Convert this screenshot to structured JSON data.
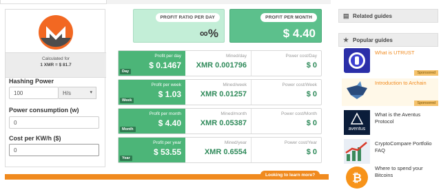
{
  "left": {
    "calculated_for": "Calculated for",
    "rate": "1 XMR = $ 81.7",
    "hashing_label": "Hashing Power",
    "hashing_value": "100",
    "hashing_unit": "H/s",
    "power_label": "Power consumption (w)",
    "power_value": "0",
    "cost_label": "Cost per KW/h ($)",
    "cost_value": "0"
  },
  "boxes": {
    "ratio_tag": "PROFIT RATIO PER DAY",
    "ratio_value": "∞%",
    "month_tag": "PROFIT PER MONTH",
    "month_value": "$ 4.40"
  },
  "rows": [
    {
      "profit_label": "Profit per day",
      "profit": "$ 0.1467",
      "period": "Day",
      "mined_label": "Mined/day",
      "mined": "XMR 0.001796",
      "power_label": "Power cost/Day",
      "power": "$ 0"
    },
    {
      "profit_label": "Profit per week",
      "profit": "$ 1.03",
      "period": "Week",
      "mined_label": "Mined/week",
      "mined": "XMR 0.01257",
      "power_label": "Power cost/Week",
      "power": "$ 0"
    },
    {
      "profit_label": "Profit per month",
      "profit": "$ 4.40",
      "period": "Month",
      "mined_label": "Mined/month",
      "mined": "XMR 0.05387",
      "power_label": "Power cost/Month",
      "power": "$ 0"
    },
    {
      "profit_label": "Profit per year",
      "profit": "$ 53.55",
      "period": "Year",
      "mined_label": "Mined/year",
      "mined": "XMR 0.6554",
      "power_label": "Power cost/Year",
      "power": "$ 0"
    }
  ],
  "learn_more": "Looking to learn more?",
  "sidebar": {
    "related_title": "Related guides",
    "popular_title": "Popular guides",
    "guides": [
      {
        "title": "What is UTRUST",
        "sponsored": "Sponsored",
        "thumb": "utrust-icon"
      },
      {
        "title": "Introduction to Archain",
        "sponsored": "Sponsored",
        "thumb": "archain-icon"
      },
      {
        "title": "What is the Aventus Protocol",
        "thumb": "aventus-logo",
        "logo_text": "aventus"
      },
      {
        "title": "CryptoCompare Portfolio FAQ",
        "thumb": "chart-arrow-icon"
      },
      {
        "title": "Where to spend your Bitcoins",
        "thumb": "bitcoin-icon"
      }
    ]
  },
  "colors": {
    "green": "#4cb578",
    "light_green": "#c3eed7",
    "orange": "#f08a1e",
    "monero": "#f26822"
  }
}
